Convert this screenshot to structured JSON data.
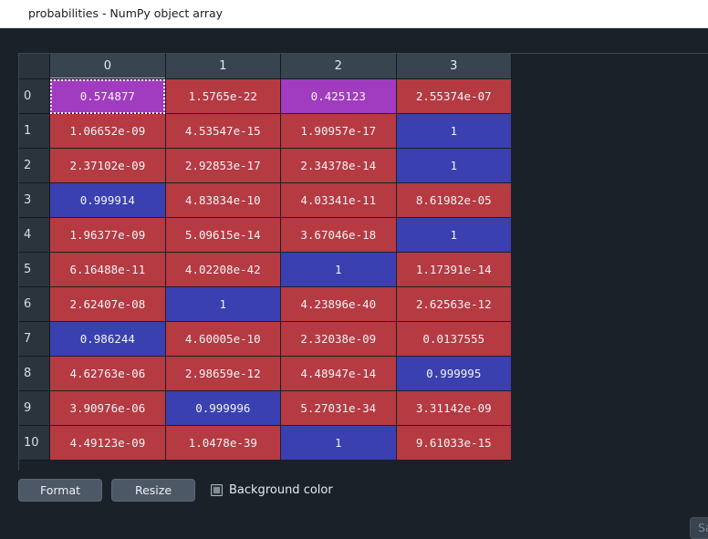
{
  "window": {
    "title": "probabilities - NumPy object array"
  },
  "table": {
    "column_headers": [
      "0",
      "1",
      "2",
      "3"
    ],
    "row_headers": [
      "0",
      "1",
      "2",
      "3",
      "4",
      "5",
      "6",
      "7",
      "8",
      "9",
      "10"
    ],
    "focused_column": "0",
    "selected_cell": {
      "row": 0,
      "col": 0
    },
    "colors": {
      "red": "#b63a42",
      "blue": "#3a40b0",
      "purple": "#a13bbf",
      "header": "#384450",
      "row_header": "#2b333c",
      "background": "#1b2129"
    },
    "rows": [
      {
        "header": "0",
        "cells": [
          {
            "value": "0.574877",
            "color": "purple",
            "selected": true
          },
          {
            "value": "1.5765e-22",
            "color": "red",
            "selected": false
          },
          {
            "value": "0.425123",
            "color": "purple",
            "selected": false
          },
          {
            "value": "2.55374e-07",
            "color": "red",
            "selected": false
          }
        ]
      },
      {
        "header": "1",
        "cells": [
          {
            "value": "1.06652e-09",
            "color": "red",
            "selected": false
          },
          {
            "value": "4.53547e-15",
            "color": "red",
            "selected": false
          },
          {
            "value": "1.90957e-17",
            "color": "red",
            "selected": false
          },
          {
            "value": "1",
            "color": "blue",
            "selected": false
          }
        ]
      },
      {
        "header": "2",
        "cells": [
          {
            "value": "2.37102e-09",
            "color": "red",
            "selected": false
          },
          {
            "value": "2.92853e-17",
            "color": "red",
            "selected": false
          },
          {
            "value": "2.34378e-14",
            "color": "red",
            "selected": false
          },
          {
            "value": "1",
            "color": "blue",
            "selected": false
          }
        ]
      },
      {
        "header": "3",
        "cells": [
          {
            "value": "0.999914",
            "color": "blue",
            "selected": false
          },
          {
            "value": "4.83834e-10",
            "color": "red",
            "selected": false
          },
          {
            "value": "4.03341e-11",
            "color": "red",
            "selected": false
          },
          {
            "value": "8.61982e-05",
            "color": "red",
            "selected": false
          }
        ]
      },
      {
        "header": "4",
        "cells": [
          {
            "value": "1.96377e-09",
            "color": "red",
            "selected": false
          },
          {
            "value": "5.09615e-14",
            "color": "red",
            "selected": false
          },
          {
            "value": "3.67046e-18",
            "color": "red",
            "selected": false
          },
          {
            "value": "1",
            "color": "blue",
            "selected": false
          }
        ]
      },
      {
        "header": "5",
        "cells": [
          {
            "value": "6.16488e-11",
            "color": "red",
            "selected": false
          },
          {
            "value": "4.02208e-42",
            "color": "red",
            "selected": false
          },
          {
            "value": "1",
            "color": "blue",
            "selected": false
          },
          {
            "value": "1.17391e-14",
            "color": "red",
            "selected": false
          }
        ]
      },
      {
        "header": "6",
        "cells": [
          {
            "value": "2.62407e-08",
            "color": "red",
            "selected": false
          },
          {
            "value": "1",
            "color": "blue",
            "selected": false
          },
          {
            "value": "4.23896e-40",
            "color": "red",
            "selected": false
          },
          {
            "value": "2.62563e-12",
            "color": "red",
            "selected": false
          }
        ]
      },
      {
        "header": "7",
        "cells": [
          {
            "value": "0.986244",
            "color": "blue",
            "selected": false
          },
          {
            "value": "4.60005e-10",
            "color": "red",
            "selected": false
          },
          {
            "value": "2.32038e-09",
            "color": "red",
            "selected": false
          },
          {
            "value": "0.0137555",
            "color": "red",
            "selected": false
          }
        ]
      },
      {
        "header": "8",
        "cells": [
          {
            "value": "4.62763e-06",
            "color": "red",
            "selected": false
          },
          {
            "value": "2.98659e-12",
            "color": "red",
            "selected": false
          },
          {
            "value": "4.48947e-14",
            "color": "red",
            "selected": false
          },
          {
            "value": "0.999995",
            "color": "blue",
            "selected": false
          }
        ]
      },
      {
        "header": "9",
        "cells": [
          {
            "value": "3.90976e-06",
            "color": "red",
            "selected": false
          },
          {
            "value": "0.999996",
            "color": "blue",
            "selected": false
          },
          {
            "value": "5.27031e-34",
            "color": "red",
            "selected": false
          },
          {
            "value": "3.31142e-09",
            "color": "red",
            "selected": false
          }
        ]
      },
      {
        "header": "10",
        "cells": [
          {
            "value": "4.49123e-09",
            "color": "red",
            "selected": false
          },
          {
            "value": "1.0478e-39",
            "color": "red",
            "selected": false
          },
          {
            "value": "1",
            "color": "blue",
            "selected": false
          },
          {
            "value": "9.61033e-15",
            "color": "red",
            "selected": false
          }
        ]
      }
    ]
  },
  "toolbar": {
    "format_label": "Format",
    "resize_label": "Resize",
    "background_color_label": "Background color",
    "background_color_checked": true
  },
  "footer": {
    "save_label": "Sav"
  }
}
